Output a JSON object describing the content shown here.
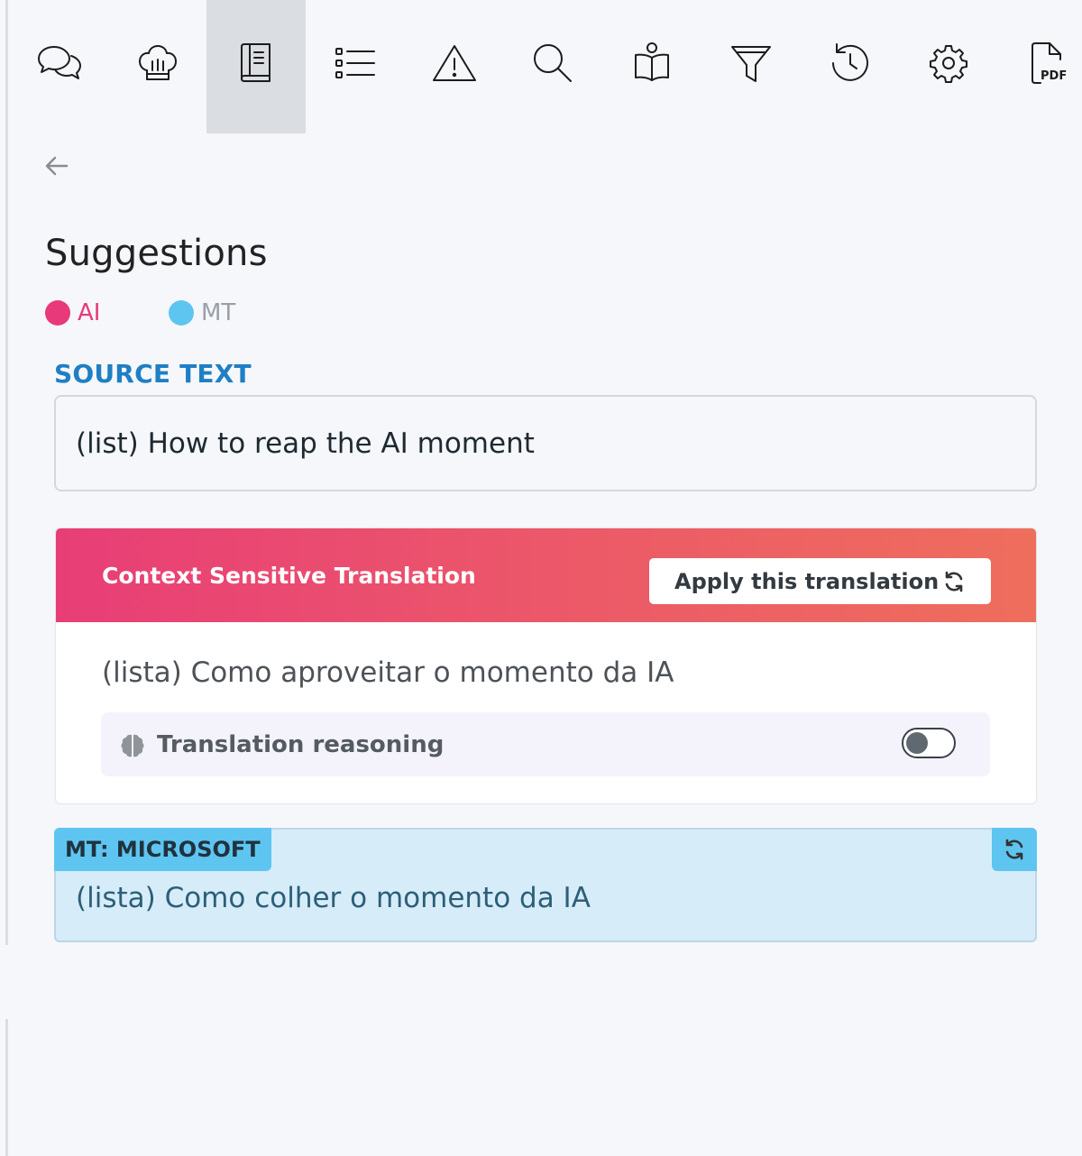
{
  "toolbar": {
    "active_index": 2,
    "items": [
      {
        "icon": "comments-icon"
      },
      {
        "icon": "chef-hat-icon"
      },
      {
        "icon": "book-icon"
      },
      {
        "icon": "list-icon"
      },
      {
        "icon": "warning-icon"
      },
      {
        "icon": "search-icon"
      },
      {
        "icon": "reader-icon"
      },
      {
        "icon": "filter-icon"
      },
      {
        "icon": "history-icon"
      },
      {
        "icon": "gear-icon"
      },
      {
        "icon": "pdf-file-icon",
        "label": "PDF"
      }
    ]
  },
  "nav": {
    "back_icon": "arrow-left-icon"
  },
  "panel": {
    "title": "Suggestions"
  },
  "legend": {
    "ai": {
      "label": "AI",
      "color": "#e8397a"
    },
    "mt": {
      "label": "MT",
      "color": "#5ec5f0"
    }
  },
  "source": {
    "label": "SOURCE TEXT",
    "text": "(list) How to reap the AI moment"
  },
  "cst": {
    "title": "Context Sensitive Translation",
    "apply_label": "Apply this translation",
    "translation": "(lista) Como aproveitar o momento da IA",
    "reasoning_label": "Translation reasoning",
    "reasoning_enabled": false
  },
  "mt": {
    "tag": "MT: MICROSOFT",
    "translation": "(lista) Como colher o momento da IA"
  }
}
